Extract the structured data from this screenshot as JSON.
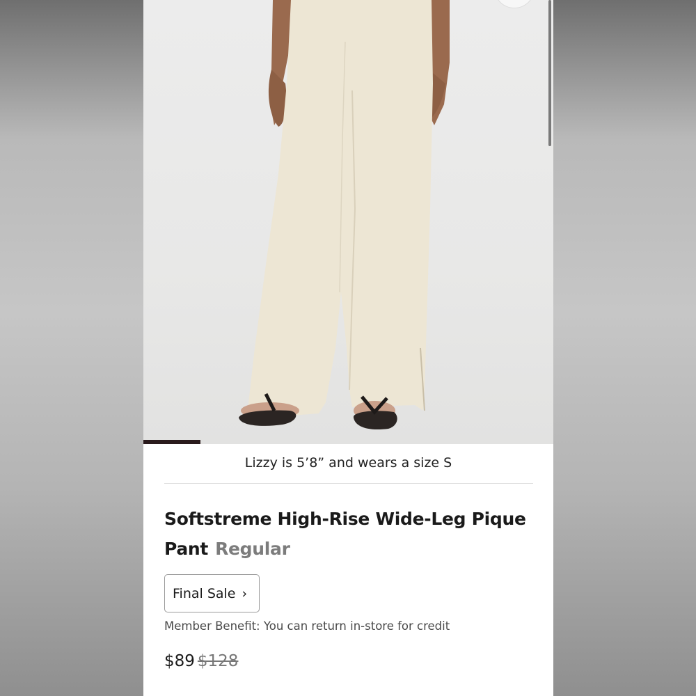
{
  "product": {
    "model_caption": "Lizzy is 5’8” and wears a size S",
    "title": "Softstreme High-Rise Wide-Leg Pique Pant",
    "fit": "Regular",
    "final_sale_label": "Final Sale",
    "member_benefit": "Member Benefit: You can return in-store for credit",
    "price": "$89",
    "original_price": "$128"
  },
  "gallery": {
    "image_progress": 0.14
  },
  "icons": {
    "final_sale_chevron": "chevron-right-icon"
  },
  "colors": {
    "pant": "#ede6d4",
    "progress": "#2a1a1c",
    "fit_text": "#7c7c7c"
  }
}
